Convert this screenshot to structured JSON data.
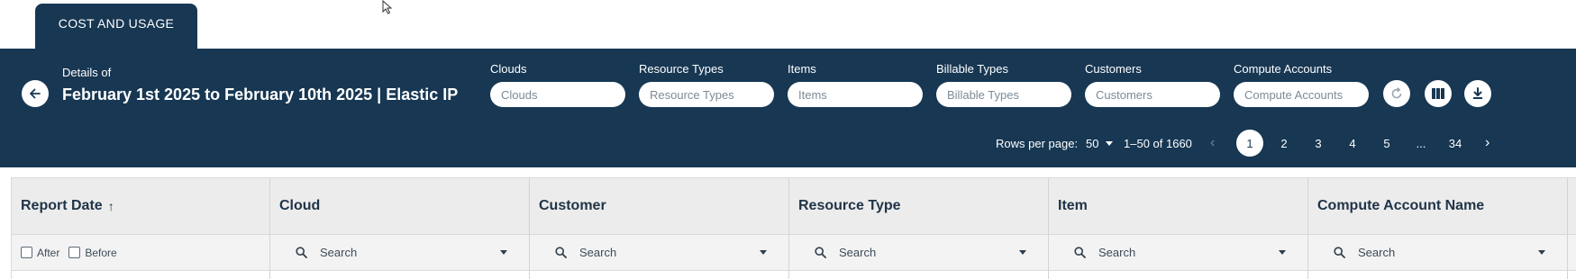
{
  "tabs": [
    {
      "label": "COST AND USAGE"
    }
  ],
  "header": {
    "details_label": "Details of",
    "title": "February 1st 2025 to February 10th 2025 | Elastic IP"
  },
  "filters": [
    {
      "label": "Clouds",
      "placeholder": "Clouds"
    },
    {
      "label": "Resource Types",
      "placeholder": "Resource Types"
    },
    {
      "label": "Items",
      "placeholder": "Items"
    },
    {
      "label": "Billable Types",
      "placeholder": "Billable Types"
    },
    {
      "label": "Customers",
      "placeholder": "Customers"
    },
    {
      "label": "Compute Accounts",
      "placeholder": "Compute Accounts"
    }
  ],
  "actions": [
    {
      "icon": "refresh-icon"
    },
    {
      "icon": "columns-icon"
    },
    {
      "icon": "download-icon"
    }
  ],
  "pagination": {
    "rows_per_page_label": "Rows per page:",
    "rows_per_page_value": "50",
    "range": "1–50 of 1660",
    "prev": "‹",
    "next": "›",
    "pages": [
      "1",
      "2",
      "3",
      "4",
      "5",
      "...",
      "34"
    ],
    "current_page": "1"
  },
  "table": {
    "columns": [
      {
        "title": "Report Date",
        "sort": "↑"
      },
      {
        "title": "Cloud"
      },
      {
        "title": "Customer"
      },
      {
        "title": "Resource Type"
      },
      {
        "title": "Item"
      },
      {
        "title": "Compute Account Name"
      }
    ],
    "date_filters": {
      "after": "After",
      "before": "Before"
    },
    "search_placeholder": "Search"
  },
  "colors": {
    "header_bg": "#173753",
    "table_header_bg": "#ececec",
    "filter_row_bg": "#f3f3f3"
  }
}
